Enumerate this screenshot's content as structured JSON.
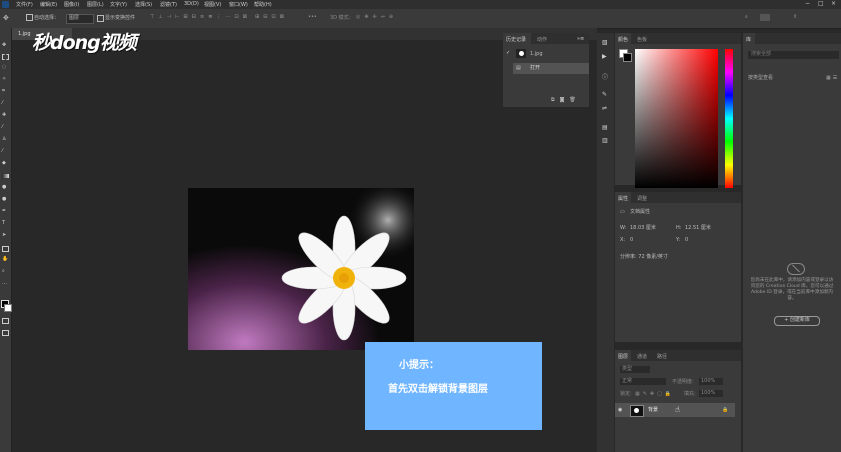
{
  "menu": [
    "文件(F)",
    "编辑(E)",
    "图像(I)",
    "图层(L)",
    "文字(Y)",
    "选择(S)",
    "滤镜(T)",
    "3D(D)",
    "视图(V)",
    "窗口(W)",
    "帮助(H)"
  ],
  "options": {
    "auto_select_label": "自动选择：",
    "auto_select_value": "图层",
    "show_transform_label": "显示变换控件",
    "mode_3d": "3D 模式："
  },
  "document": {
    "tab_label": "1.jpg"
  },
  "watermark": {
    "text": "秒dong视频"
  },
  "history_panel": {
    "tabs": [
      "历史记录",
      "动作"
    ],
    "snapshot": "1.jpg",
    "step": "打开"
  },
  "color_panel": {
    "tabs": [
      "颜色",
      "色板"
    ]
  },
  "properties_panel": {
    "tabs": [
      "属性",
      "调整"
    ],
    "section": "文档属性",
    "w_label": "W:",
    "w_value": "18.03 厘米",
    "h_label": "H:",
    "h_value": "12.51 厘米",
    "x_label": "X:",
    "x_value": "0",
    "y_label": "Y:",
    "y_value": "0",
    "resolution": "分辨率: 72 像素/英寸"
  },
  "layers_panel": {
    "tabs": [
      "图层",
      "通道",
      "路径"
    ],
    "kind": "类型",
    "blend": "正常",
    "opacity_label": "不透明度:",
    "opacity": "100%",
    "lock_label": "锁定:",
    "fill_label": "填充:",
    "fill": "100%",
    "layer_name": "背景"
  },
  "libraries_panel": {
    "tab": "库",
    "search_placeholder": "搜索全部",
    "filter": "按类型查看",
    "empty_text": "您尚未在此库中，请添加内容或登录以访问您的 Creative Cloud 库。您可以通过 Adobe ID 登录，或在当前库中添加新内容。",
    "create_button": "+ 创建新库"
  },
  "tip": {
    "title": "小提示：",
    "line": "首先双击解锁背景图层"
  },
  "colors": {
    "tip_bg": "#6fb5ff",
    "panel": "#3a3a3a",
    "workspace": "#282828"
  }
}
